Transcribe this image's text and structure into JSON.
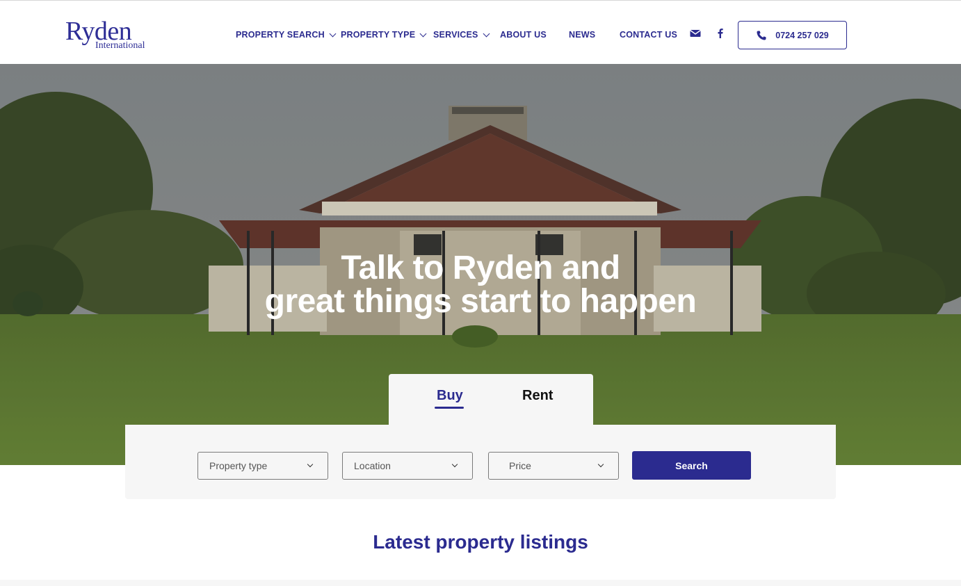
{
  "header": {
    "logo": {
      "main": "Ryden",
      "sub": "International"
    },
    "nav": [
      {
        "label": "PROPERTY SEARCH",
        "dropdown": true
      },
      {
        "label": "PROPERTY TYPE",
        "dropdown": true
      },
      {
        "label": "SERVICES",
        "dropdown": true
      },
      {
        "label": "ABOUT US",
        "dropdown": false
      },
      {
        "label": "NEWS",
        "dropdown": false
      },
      {
        "label": "CONTACT US",
        "dropdown": false
      }
    ],
    "icons": {
      "email": "mail-icon",
      "facebook": "facebook-icon",
      "phone": "phone-icon"
    },
    "phone": "0724 257 029"
  },
  "hero": {
    "title_line1": "Talk to Ryden and",
    "title_line2": "great things start to happen"
  },
  "search": {
    "tabs": [
      {
        "label": "Buy",
        "active": true
      },
      {
        "label": "Rent",
        "active": false
      }
    ],
    "fields": {
      "property_type": "Property type",
      "location": "Location",
      "price": "Price"
    },
    "button": "Search"
  },
  "listings": {
    "title": "Latest property listings"
  },
  "colors": {
    "brand": "#2b2b8f",
    "panel": "#f6f6f6"
  }
}
